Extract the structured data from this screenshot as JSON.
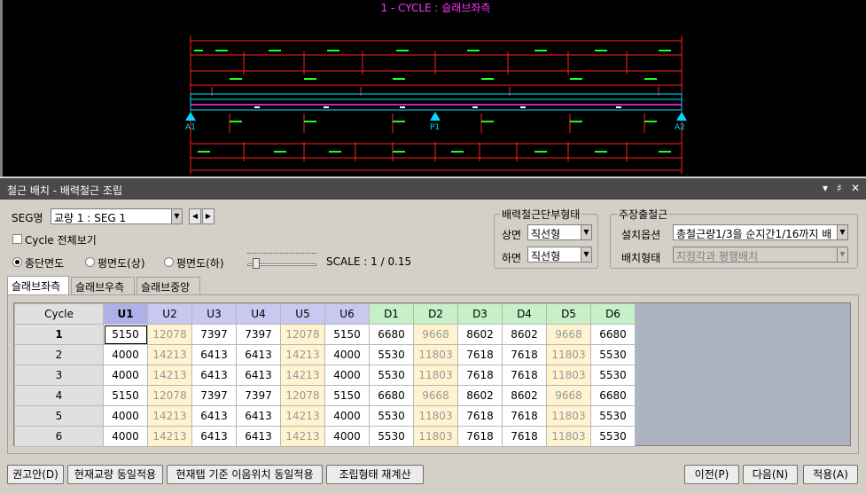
{
  "cad": {
    "title": "1 - CYCLE : 슬래브좌측",
    "supports": [
      "A1",
      "P1",
      "A2"
    ]
  },
  "panel": {
    "title": "철근 배치 - 배력철근 조립",
    "btn_menu": "▾",
    "btn_pin": "♯",
    "btn_close": "✕"
  },
  "controls": {
    "seg_label": "SEG명",
    "seg_value": "교량 1 : SEG 1",
    "cycle_all_label": "Cycle 전체보기",
    "view_options": [
      "종단면도",
      "평면도(상)",
      "평면도(하)"
    ],
    "selected_view": 0,
    "scale_label": "SCALE : 1 / 0.15"
  },
  "end_group": {
    "title": "배력철근단부형태",
    "top_label": "상면",
    "top_value": "직선형",
    "bottom_label": "하면",
    "bottom_value": "직선형"
  },
  "main_group": {
    "title": "주장출철근",
    "install_label": "설치옵션",
    "install_value": "총철근량1/3을 순지간1/16까지 배",
    "layout_label": "배치형태",
    "layout_value": "지점각과 평행배치"
  },
  "tabs": [
    "슬래브좌측",
    "슬래브우측",
    "슬래브중앙"
  ],
  "active_tab": 0,
  "table": {
    "corner": "Cycle",
    "columns": [
      "U1",
      "U2",
      "U3",
      "U4",
      "U5",
      "U6",
      "D1",
      "D2",
      "D3",
      "D4",
      "D5",
      "D6"
    ],
    "rows": [
      {
        "cycle": "1",
        "values": [
          "5150",
          "12078",
          "7397",
          "7397",
          "12078",
          "5150",
          "6680",
          "9668",
          "8602",
          "8602",
          "9668",
          "6680"
        ]
      },
      {
        "cycle": "2",
        "values": [
          "4000",
          "14213",
          "6413",
          "6413",
          "14213",
          "4000",
          "5530",
          "11803",
          "7618",
          "7618",
          "11803",
          "5530"
        ]
      },
      {
        "cycle": "3",
        "values": [
          "4000",
          "14213",
          "6413",
          "6413",
          "14213",
          "4000",
          "5530",
          "11803",
          "7618",
          "7618",
          "11803",
          "5530"
        ]
      },
      {
        "cycle": "4",
        "values": [
          "5150",
          "12078",
          "7397",
          "7397",
          "12078",
          "5150",
          "6680",
          "9668",
          "8602",
          "8602",
          "9668",
          "6680"
        ]
      },
      {
        "cycle": "5",
        "values": [
          "4000",
          "14213",
          "6413",
          "6413",
          "14213",
          "4000",
          "5530",
          "11803",
          "7618",
          "7618",
          "11803",
          "5530"
        ]
      },
      {
        "cycle": "6",
        "values": [
          "4000",
          "14213",
          "6413",
          "6413",
          "14213",
          "4000",
          "5530",
          "11803",
          "7618",
          "7618",
          "11803",
          "5530"
        ]
      }
    ]
  },
  "buttons": {
    "recommend": "권고안(D)",
    "apply_bridge": "현재교량 동일적용",
    "apply_tab": "현재탭 기준 이음위치 동일적용",
    "recalc": "조립형태 재계산",
    "prev": "이전(P)",
    "next": "다음(N)",
    "apply": "적용(A)"
  }
}
